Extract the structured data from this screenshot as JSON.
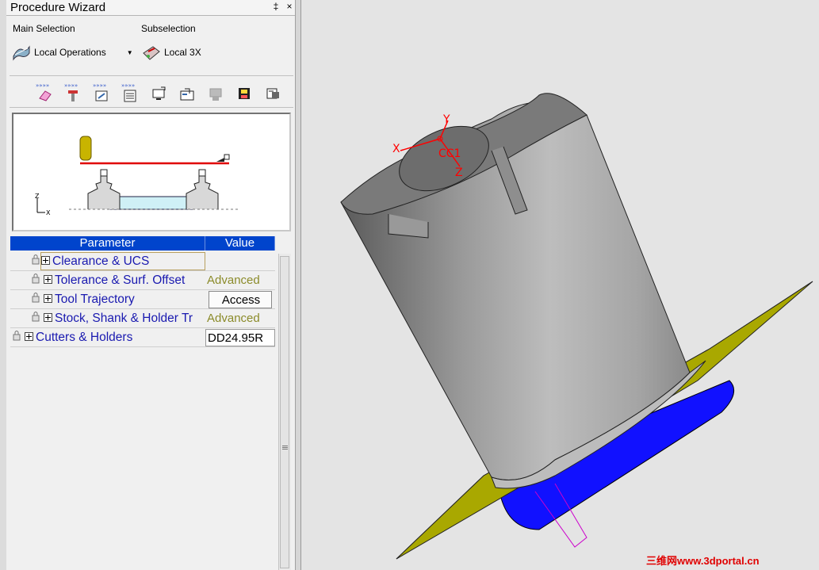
{
  "window": {
    "title": "Procedure Wizard",
    "pin_glyph": "‡",
    "close_glyph": "×"
  },
  "selection": {
    "main_label": "Main Selection",
    "sub_label": "Subselection",
    "main_value": "Local Operations",
    "sub_value": "Local 3X"
  },
  "toolbar": {
    "icons": [
      "next-eraser-icon",
      "next-tool-icon",
      "next-wizard-icon",
      "next-list-icon",
      "monitor-icon",
      "transfer-icon",
      "disabled-icon",
      "save-icon",
      "machine-icon"
    ]
  },
  "preview": {
    "axis_z": "Z",
    "axis_x": "X"
  },
  "table": {
    "headers": {
      "parameter": "Parameter",
      "value": "Value"
    },
    "rows": [
      {
        "name": "Clearance & UCS",
        "value": ""
      },
      {
        "name": "Tolerance & Surf. Offset",
        "value": "Advanced"
      },
      {
        "name": "Tool Trajectory",
        "value": "Access"
      },
      {
        "name": "Stock, Shank & Holder Tr",
        "value": "Advanced"
      },
      {
        "name": "Cutters & Holders",
        "value": "DD24.95R"
      }
    ]
  },
  "viewport": {
    "labels": {
      "y": "Y",
      "x": "X",
      "cc": "CC1",
      "z": "Z"
    },
    "colors": {
      "part": "#8a8a8a",
      "plane": "#b0ae00",
      "base": "#1111ff",
      "axis": "#ff0000"
    }
  },
  "watermark": "三维网www.3dportal.cn"
}
